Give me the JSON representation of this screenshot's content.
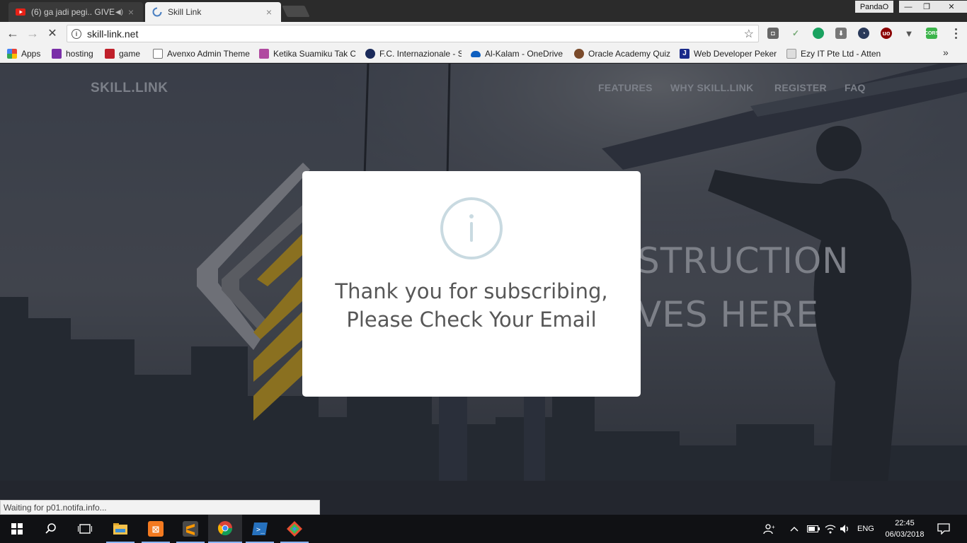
{
  "browser": {
    "tabs": [
      {
        "title": "(6) ga jadi pegi.. GIVE",
        "active": false,
        "favicon": "youtube-icon"
      },
      {
        "title": "Skill Link",
        "active": true,
        "favicon": "loading-spinner-icon"
      }
    ],
    "profile_name": "PandaO",
    "url": "skill-link.net",
    "status_text": "Waiting for p01.notifa.info..."
  },
  "bookmarks": [
    {
      "label": "Apps",
      "icon": "apps-grid-icon"
    },
    {
      "label": "hosting",
      "icon": "hosting-icon"
    },
    {
      "label": "game",
      "icon": "game-icon"
    },
    {
      "label": "Avenxo Admin Theme",
      "icon": "page-icon"
    },
    {
      "label": "Ketika Suamiku Tak C",
      "icon": "bookmark-icon"
    },
    {
      "label": "F.C. Internazionale - S",
      "icon": "inter-icon"
    },
    {
      "label": "Al-Kalam - OneDrive",
      "icon": "onedrive-icon"
    },
    {
      "label": "Oracle Academy Quiz",
      "icon": "oracle-icon"
    },
    {
      "label": "Web Developer Peker",
      "icon": "j-icon"
    },
    {
      "label": "Ezy IT Pte Ltd - Atten",
      "icon": "ezy-icon"
    }
  ],
  "site": {
    "logo": "SKILL.LINK",
    "nav": [
      "FEATURES",
      "WHY SKILL.LINK",
      "REGISTER",
      "FAQ"
    ],
    "hero_line1": "STRUCTION",
    "hero_line2": "VES HERE"
  },
  "modal": {
    "line1": "Thank you for subscribing,",
    "line2": "Please Check Your Email",
    "icon": "info-icon"
  },
  "taskbar": {
    "language": "ENG",
    "time": "22:45",
    "date": "06/03/2018"
  },
  "colors": {
    "modal_bg": "#ffffff",
    "info_ring": "#c9dae1",
    "logo_gold": "#c9a227"
  }
}
